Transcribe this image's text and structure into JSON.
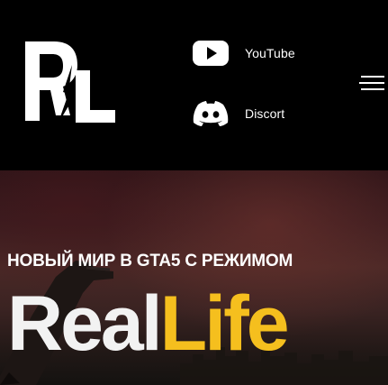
{
  "header": {
    "logo": {
      "icon": "rl-logo-icon",
      "alt": "RL"
    },
    "social": [
      {
        "icon": "youtube-icon",
        "label": "YouTube"
      },
      {
        "icon": "discord-icon",
        "label": "Discort"
      }
    ],
    "menu_icon": "hamburger-menu-icon"
  },
  "hero": {
    "subtitle": "НОВЫЙ МИР В GTA5 С РЕЖИМОМ",
    "title_part1": "Real",
    "title_part2": "Life"
  },
  "colors": {
    "header_bg": "#000000",
    "title_white": "#f2f2f2",
    "title_accent": "#f5bf1e",
    "hero_bg": "#3b1c1f"
  }
}
